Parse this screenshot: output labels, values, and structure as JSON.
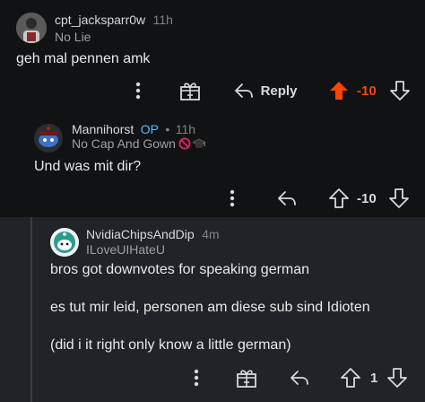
{
  "comments": [
    {
      "author": "cpt_jacksparr0w",
      "time": "11h",
      "flair": "No Lie",
      "body": "geh mal pennen amk",
      "score": "-10",
      "reply_label": "Reply"
    },
    {
      "author": "Mannihorst",
      "op_badge": "OP",
      "separator": "•",
      "time": "11h",
      "flair": "No Cap And Gown",
      "body": "Und was mit dir?",
      "score": "-10"
    },
    {
      "author": "NvidiaChipsAndDip",
      "time": "4m",
      "flair": "ILoveUIHateU",
      "body_lines": [
        "bros got downvotes for speaking german",
        "es tut mir leid, personen am diese sub sind Idioten",
        "(did i it right only know a little german)"
      ],
      "score": "1"
    }
  ],
  "colors": {
    "background": "#101214",
    "highlight_bg": "#202327",
    "downvote_orange": "#ff4500",
    "op_blue": "#4fbcff",
    "muted": "#818384"
  },
  "icons": {
    "more": "more-vertical-icon",
    "award": "award-gift-icon",
    "reply": "reply-arrow-icon",
    "upvote": "upvote-arrow-icon",
    "downvote": "downvote-arrow-icon",
    "no_sign": "prohibited-icon",
    "grad_cap": "graduation-cap-icon"
  }
}
